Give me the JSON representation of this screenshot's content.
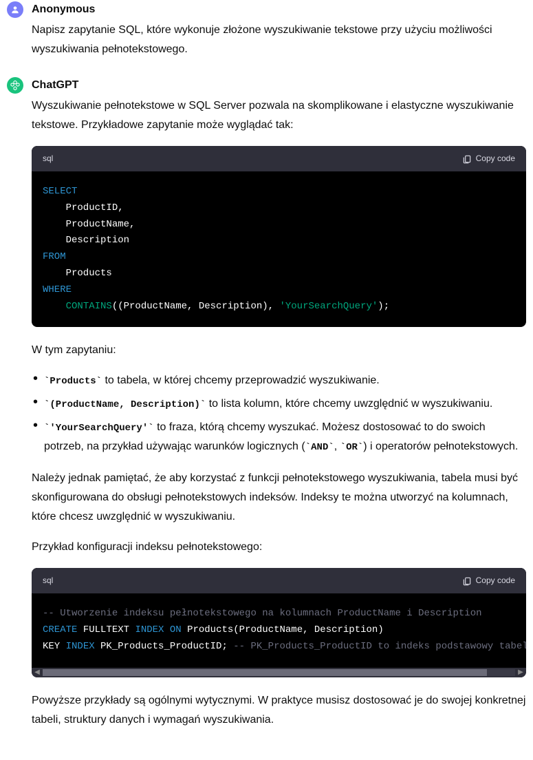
{
  "user": {
    "author": "Anonymous",
    "text": "Napisz zapytanie SQL, które wykonuje złożone wyszukiwanie tekstowe przy użyciu możliwości wyszukiwania pełnotekstowego."
  },
  "bot": {
    "author": "ChatGPT",
    "p1": "Wyszukiwanie pełnotekstowe w SQL Server pozwala na skomplikowane i elastyczne wyszukiwanie tekstowe. Przykładowe zapytanie może wyglądać tak:",
    "code1": {
      "lang": "sql",
      "copy": "Copy code",
      "l1_kw": "SELECT",
      "l2": "    ProductID,",
      "l3": "    ProductName,",
      "l4": "    Description",
      "l5_kw": "FROM",
      "l6": "    Products",
      "l7_kw": "WHERE",
      "l8_indent": "    ",
      "l8_fn": "CONTAINS",
      "l8_mid": "((ProductName, Description), ",
      "l8_str": "'YourSearchQuery'",
      "l8_end": ");"
    },
    "p2": "W tym zapytaniu:",
    "bullet1_code": "Products",
    "bullet1_text": " to tabela, w której chcemy przeprowadzić wyszukiwanie.",
    "bullet2_code": "(ProductName, Description)",
    "bullet2_text": " to lista kolumn, które chcemy uwzględnić w wyszukiwaniu.",
    "bullet3_code": "'YourSearchQuery'",
    "bullet3_text_a": " to fraza, którą chcemy wyszukać. Możesz dostosować to do swoich potrzeb, na przykład używając warunków logicznych (",
    "bullet3_and": "AND",
    "bullet3_sep": ", ",
    "bullet3_or": "OR",
    "bullet3_text_b": ") i operatorów pełnotekstowych.",
    "p3": "Należy jednak pamiętać, że aby korzystać z funkcji pełnotekstowego wyszukiwania, tabela musi być skonfigurowana do obsługi pełnotekstowych indeksów. Indeksy te można utworzyć na kolumnach, które chcesz uwzględnić w wyszukiwaniu.",
    "p4": "Przykład konfiguracji indeksu pełnotekstowego:",
    "code2": {
      "lang": "sql",
      "copy": "Copy code",
      "l1_com": "-- Utworzenie indeksu pełnotekstowego na kolumnach ProductName i Description",
      "l2_kw1": "CREATE",
      "l2_mid1": " FULLTEXT ",
      "l2_kw2": "INDEX",
      "l2_mid2": " ",
      "l2_kw3": "ON",
      "l2_rest": " Products(ProductName, Description)",
      "l3_a": "KEY ",
      "l3_kw": "INDEX",
      "l3_b": " PK_Products_ProductID; ",
      "l3_com": "-- PK_Products_ProductID to indeks podstawowy tabeli"
    },
    "p5": "Powyższe przykłady są ogólnymi wytycznymi. W praktyce musisz dostosować je do swojej konkretnej tabeli, struktury danych i wymagań wyszukiwania."
  }
}
